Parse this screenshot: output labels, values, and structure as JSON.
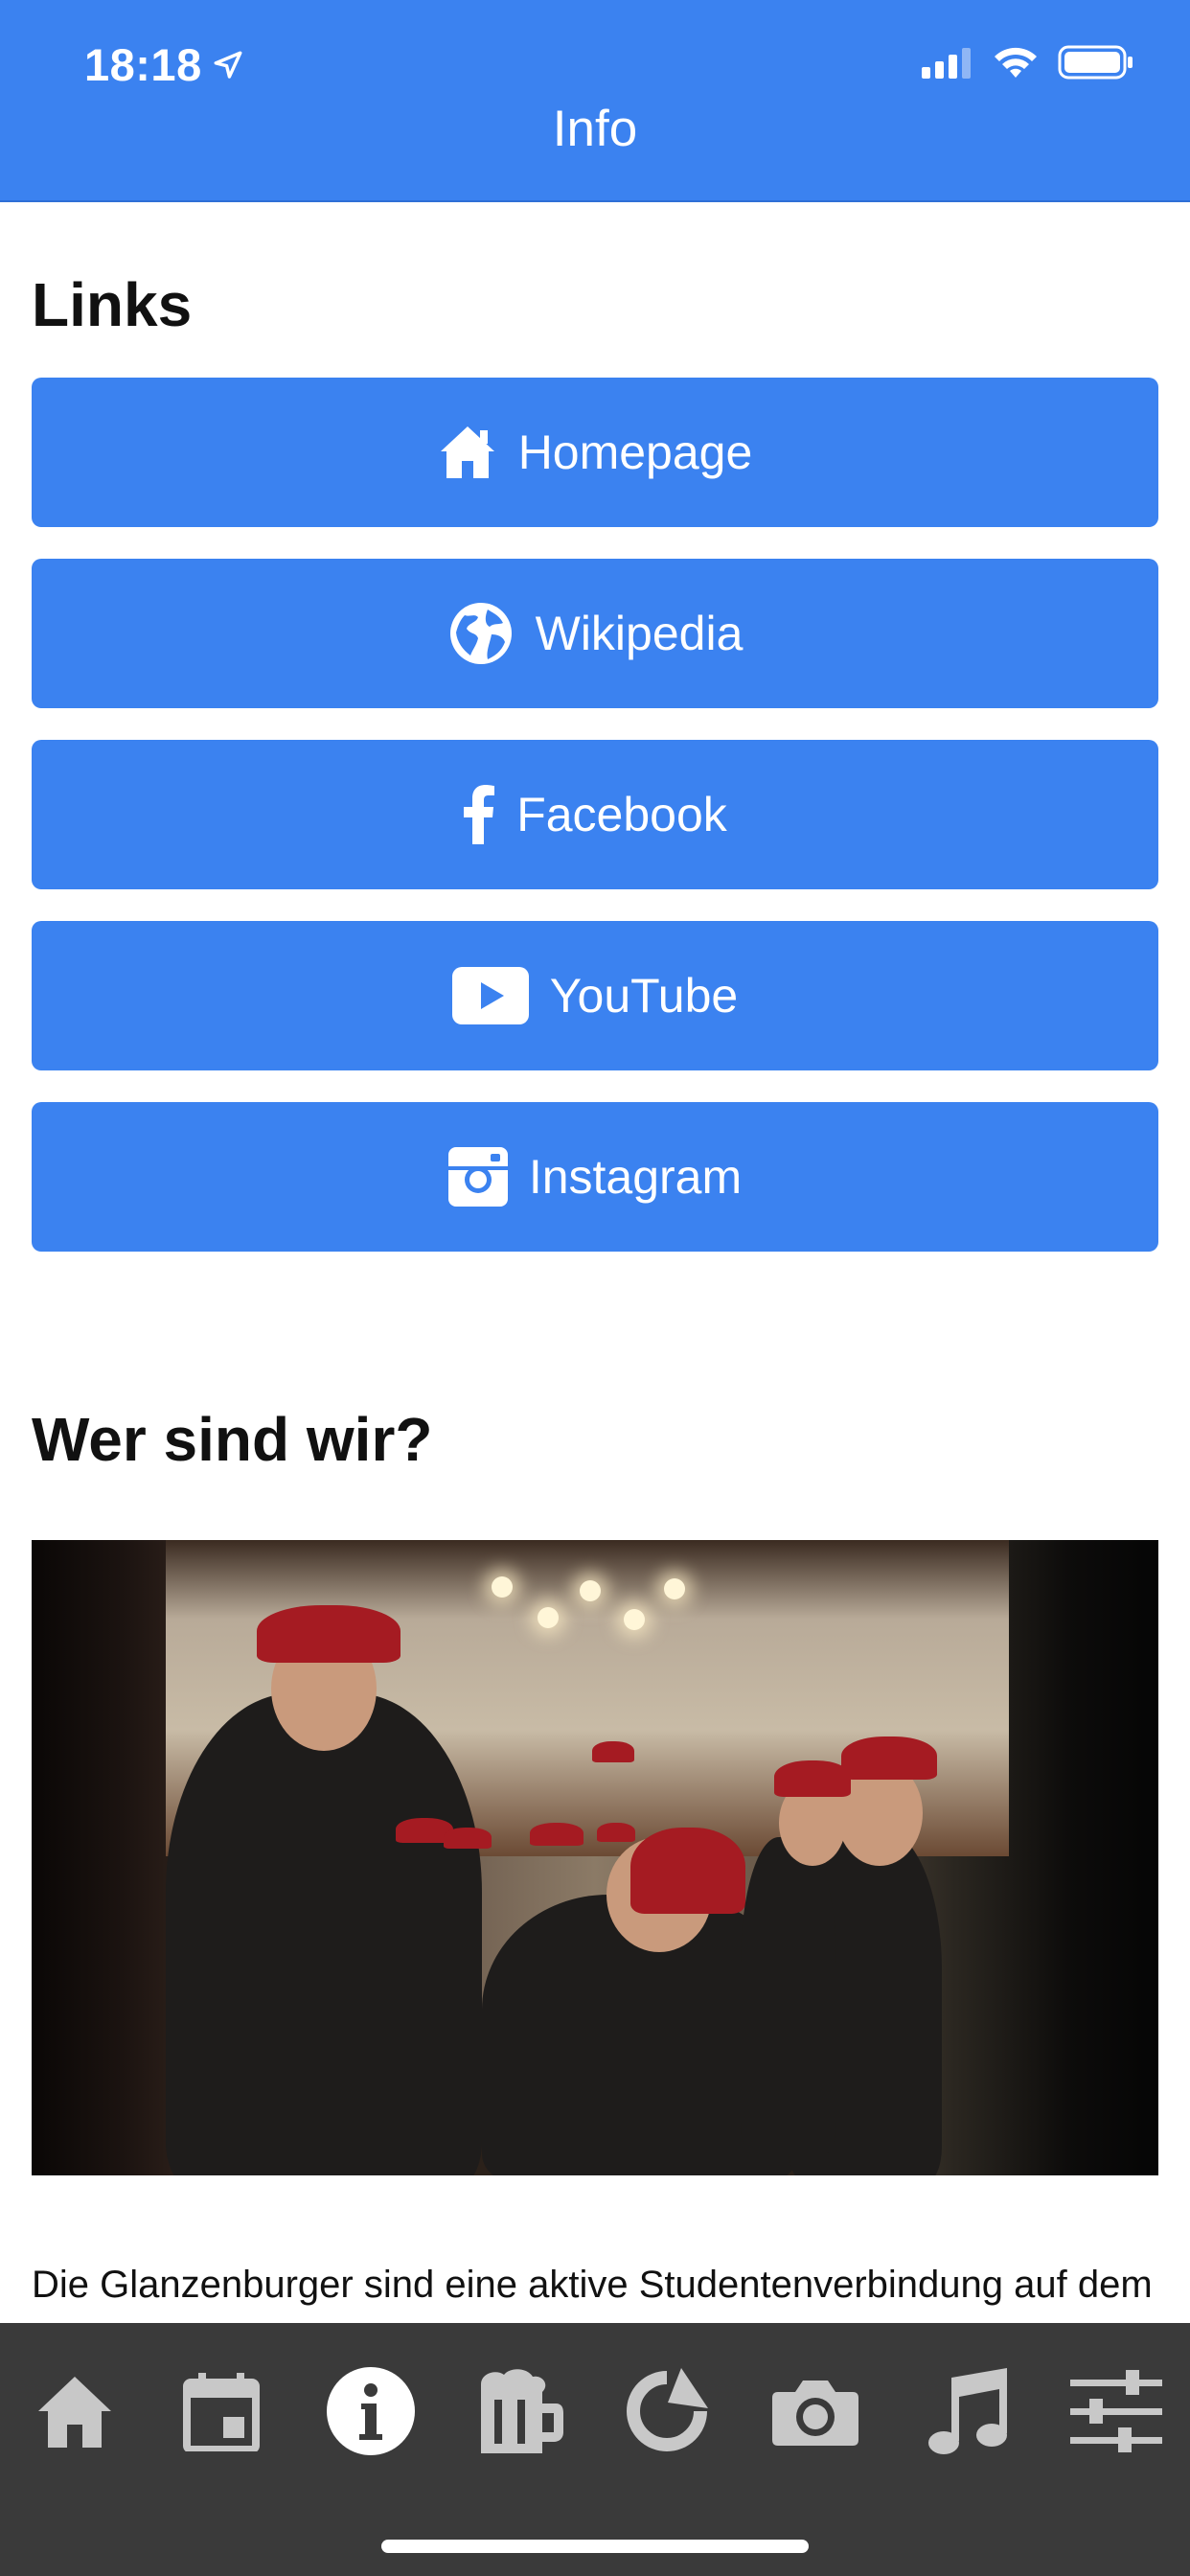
{
  "status_bar": {
    "time": "18:18"
  },
  "nav": {
    "title": "Info"
  },
  "links": {
    "title": "Links",
    "items": [
      {
        "label": "Homepage",
        "icon": "home-icon"
      },
      {
        "label": "Wikipedia",
        "icon": "globe-icon"
      },
      {
        "label": "Facebook",
        "icon": "facebook-icon"
      },
      {
        "label": "YouTube",
        "icon": "youtube-icon"
      },
      {
        "label": "Instagram",
        "icon": "instagram-icon"
      }
    ]
  },
  "about": {
    "title": "Wer sind wir?",
    "text": "Die Glanzenburger sind eine aktive Studentenverbindung auf dem Platz Zürich. Wir treffen"
  },
  "tabbar": {
    "items": [
      {
        "icon": "home-icon",
        "active": false
      },
      {
        "icon": "calendar-icon",
        "active": false
      },
      {
        "icon": "info-icon",
        "active": true
      },
      {
        "icon": "beer-mug-icon",
        "active": false
      },
      {
        "icon": "refresh-icon",
        "active": false
      },
      {
        "icon": "camera-icon",
        "active": false
      },
      {
        "icon": "music-note-icon",
        "active": false
      },
      {
        "icon": "sliders-icon",
        "active": false
      }
    ]
  },
  "colors": {
    "accent": "#3b82f0",
    "tabbar_bg": "#3a3a3a",
    "tab_icon": "#c8c8c8"
  }
}
